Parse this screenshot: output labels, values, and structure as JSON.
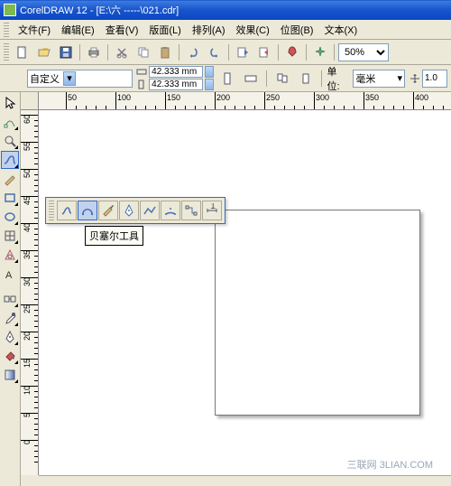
{
  "title": "CorelDRAW 12 - [E:\\六  -----\\021.cdr]",
  "menu": {
    "file": "文件(F)",
    "edit": "编辑(E)",
    "view": "查看(V)",
    "layout": "版面(L)",
    "arrange": "排列(A)",
    "effects": "效果(C)",
    "bitmaps": "位图(B)",
    "text": "文本(X)"
  },
  "toolbar": {
    "zoom_value": "50%"
  },
  "propbar": {
    "preset": "自定义",
    "width": "42.333 mm",
    "height": "42.333 mm",
    "unit_label": "单位:",
    "unit_value": "毫米",
    "nudge": "1.0"
  },
  "ruler_h_labels": [
    "50",
    "100",
    "150",
    "200",
    "250",
    "300",
    "350",
    "400"
  ],
  "ruler_v_labels": [
    "60",
    "55",
    "50",
    "45",
    "40",
    "35",
    "30",
    "25",
    "20",
    "15",
    "10",
    "5",
    "0"
  ],
  "flyout": {
    "tools": [
      "freehand",
      "bezier",
      "artistic-media",
      "pen",
      "polyline",
      "3point-curve",
      "interactive-connector",
      "dimension"
    ],
    "selected": "bezier"
  },
  "tooltip": "贝塞尔工具",
  "watermark": "三联网 3LIAN.COM",
  "colors": {
    "titlebar": "#1855cc",
    "ui_bg": "#ece9d8",
    "selection": "#c1d2ee"
  }
}
